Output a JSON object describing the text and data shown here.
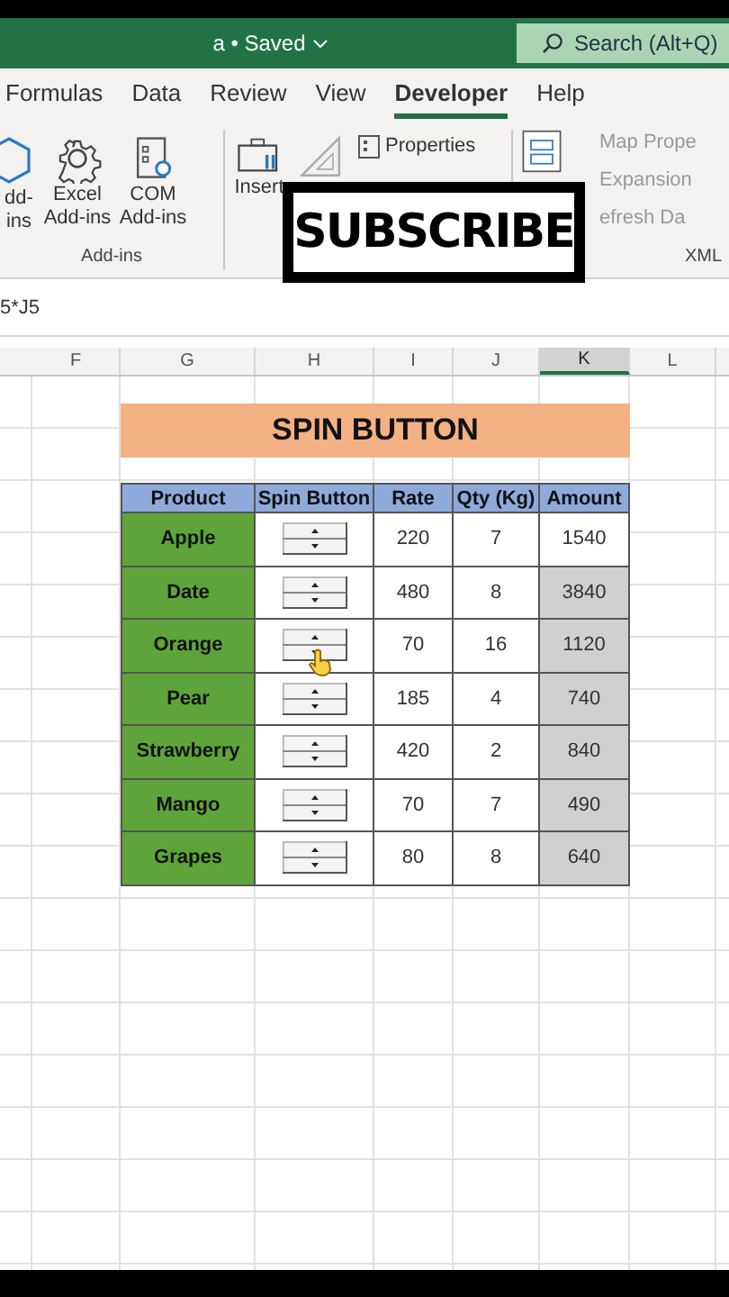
{
  "title_bar": {
    "title": "a • Saved",
    "search": {
      "placeholder": "Search (Alt+Q)"
    }
  },
  "ribbon_tabs": [
    {
      "label": "Formulas",
      "selected": false
    },
    {
      "label": "Data",
      "selected": false
    },
    {
      "label": "Review",
      "selected": false
    },
    {
      "label": "View",
      "selected": false
    },
    {
      "label": "Developer",
      "selected": true
    },
    {
      "label": "Help",
      "selected": false
    }
  ],
  "ribbon": {
    "addins_group": {
      "label": "Add-ins",
      "buttons": [
        {
          "kind": "hexagon",
          "label": "dd-ins"
        },
        {
          "kind": "gear",
          "label": "Excel Add-ins"
        },
        {
          "kind": "com",
          "label": "COM Add-ins"
        }
      ]
    },
    "controls_group": {
      "insert": "Insert",
      "properties": "Properties"
    },
    "xml_group": {
      "label": "XML",
      "items": [
        "Map Prope",
        "Expansion",
        "efresh Da"
      ]
    }
  },
  "overlay": {
    "label": "SUBSCRIBE"
  },
  "formula_bar": {
    "formula": "5*J5"
  },
  "columns": [
    {
      "label": "F",
      "selected": false
    },
    {
      "label": "G",
      "selected": false
    },
    {
      "label": "H",
      "selected": false
    },
    {
      "label": "I",
      "selected": false
    },
    {
      "label": "J",
      "selected": false
    },
    {
      "label": "K",
      "selected": true
    },
    {
      "label": "L",
      "selected": false
    }
  ],
  "sheet": {
    "title": "SPIN BUTTON",
    "headers": [
      "Product",
      "Spin Button",
      "Rate",
      "Qty (Kg)",
      "Amount"
    ],
    "rows": [
      {
        "product": "Apple",
        "rate": "220",
        "qty": "7",
        "amount": "1540",
        "selected": false
      },
      {
        "product": "Date",
        "rate": "480",
        "qty": "8",
        "amount": "3840",
        "selected": true
      },
      {
        "product": "Orange",
        "rate": "70",
        "qty": "16",
        "amount": "1120",
        "selected": true
      },
      {
        "product": "Pear",
        "rate": "185",
        "qty": "4",
        "amount": "740",
        "selected": true
      },
      {
        "product": "Strawberry",
        "rate": "420",
        "qty": "2",
        "amount": "840",
        "selected": true
      },
      {
        "product": "Mango",
        "rate": "70",
        "qty": "7",
        "amount": "490",
        "selected": true
      },
      {
        "product": "Grapes",
        "rate": "80",
        "qty": "8",
        "amount": "640",
        "selected": true
      }
    ]
  }
}
